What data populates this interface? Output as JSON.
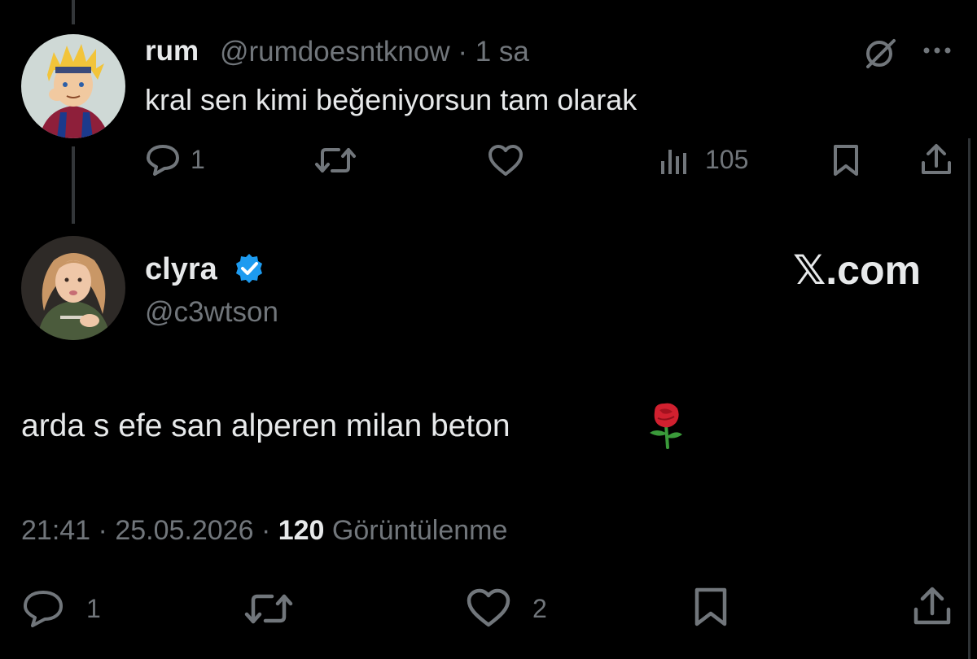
{
  "reply_tweet": {
    "display_name": "rum",
    "handle": "@rumdoesntknow",
    "separator": "·",
    "time": "1 sa",
    "text": "kral sen kimi beğeniyorsun tam olarak",
    "actions": {
      "reply_count": "1",
      "views_count": "105"
    }
  },
  "main_tweet": {
    "display_name": "clyra",
    "handle": "@c3wtson",
    "watermark": "𝕏.com",
    "text": "arda s efe san alperen milan beton",
    "emoji": "🌹",
    "time": "21:41",
    "separator": "·",
    "date": "25.05.2026",
    "views_count": "120",
    "views_label": "Görüntülenme",
    "actions": {
      "reply_count": "1",
      "like_count": "2"
    }
  },
  "colors": {
    "background": "#000000",
    "primary_text": "#e7e9ea",
    "secondary_text": "#71767b",
    "verified_badge": "#1d9bf0",
    "thread_line": "#333639"
  },
  "icons": {
    "grok": "grok-icon",
    "more": "more-icon",
    "reply": "reply-icon",
    "retweet": "retweet-icon",
    "like": "like-icon",
    "views": "views-icon",
    "bookmark": "bookmark-icon",
    "share": "share-icon",
    "verified": "verified-badge-icon"
  }
}
